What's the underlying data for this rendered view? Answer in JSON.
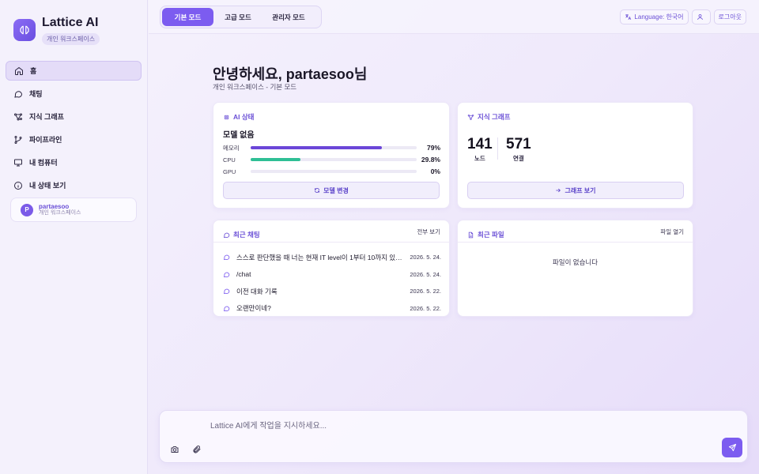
{
  "brand": {
    "name": "Lattice AI",
    "subtitle": "개인 워크스페이스"
  },
  "sidebar": {
    "items": [
      {
        "label": "홈",
        "icon": "home-icon",
        "active": true
      },
      {
        "label": "채팅",
        "icon": "chat-icon"
      },
      {
        "label": "지식 그래프",
        "icon": "graph-icon"
      },
      {
        "label": "파이프라인",
        "icon": "pipeline-icon"
      },
      {
        "label": "내 컴퓨터",
        "icon": "monitor-icon"
      },
      {
        "label": "내 상태 보기",
        "icon": "info-icon"
      }
    ],
    "user": {
      "initial": "P",
      "name": "partaesoo",
      "workspace": "개인 워크스페이스"
    }
  },
  "topbar": {
    "modes": [
      "기본 모드",
      "고급 모드",
      "관리자 모드"
    ],
    "active_mode": "기본 모드",
    "language": "Language: 한국어",
    "logout": "로그아웃"
  },
  "main": {
    "greeting": "안녕하세요, partaesoo님",
    "subtitle": "개인 워크스페이스 - 기본 모드",
    "ai_status": {
      "title": "AI 상태",
      "model": "모델 없음",
      "meters": [
        {
          "label": "메모리",
          "value": "79%",
          "fraction": 0.79,
          "color": "#6b46d8"
        },
        {
          "label": "CPU",
          "value": "29.8%",
          "fraction": 0.298,
          "color": "#2fbf95"
        },
        {
          "label": "GPU",
          "value": "0%",
          "fraction": 0,
          "color": "#6b46d8"
        }
      ],
      "button": "모델 변경"
    },
    "knowledge_graph": {
      "title": "지식 그래프",
      "nodes": "141",
      "nodes_label": "노드",
      "edges": "571",
      "edges_label": "연결",
      "button": "그래프 보기"
    },
    "recent_chats": {
      "title": "최근 채팅",
      "link": "전부 보기",
      "items": [
        {
          "text": "스스로 판단했을 때 너는 현재 IT level이 1부터 10까지 있다...",
          "date": "2026. 5. 24."
        },
        {
          "text": "/chat",
          "date": "2026. 5. 24."
        },
        {
          "text": "이전 대화 기록",
          "date": "2026. 5. 22."
        },
        {
          "text": "오랜만이네?",
          "date": "2026. 5. 22."
        }
      ]
    },
    "recent_files": {
      "title": "최근 파일",
      "link": "파일 열기",
      "empty": "파일이 없습니다"
    }
  },
  "composer": {
    "placeholder": "Lattice AI에게 작업을 지시하세요..."
  }
}
